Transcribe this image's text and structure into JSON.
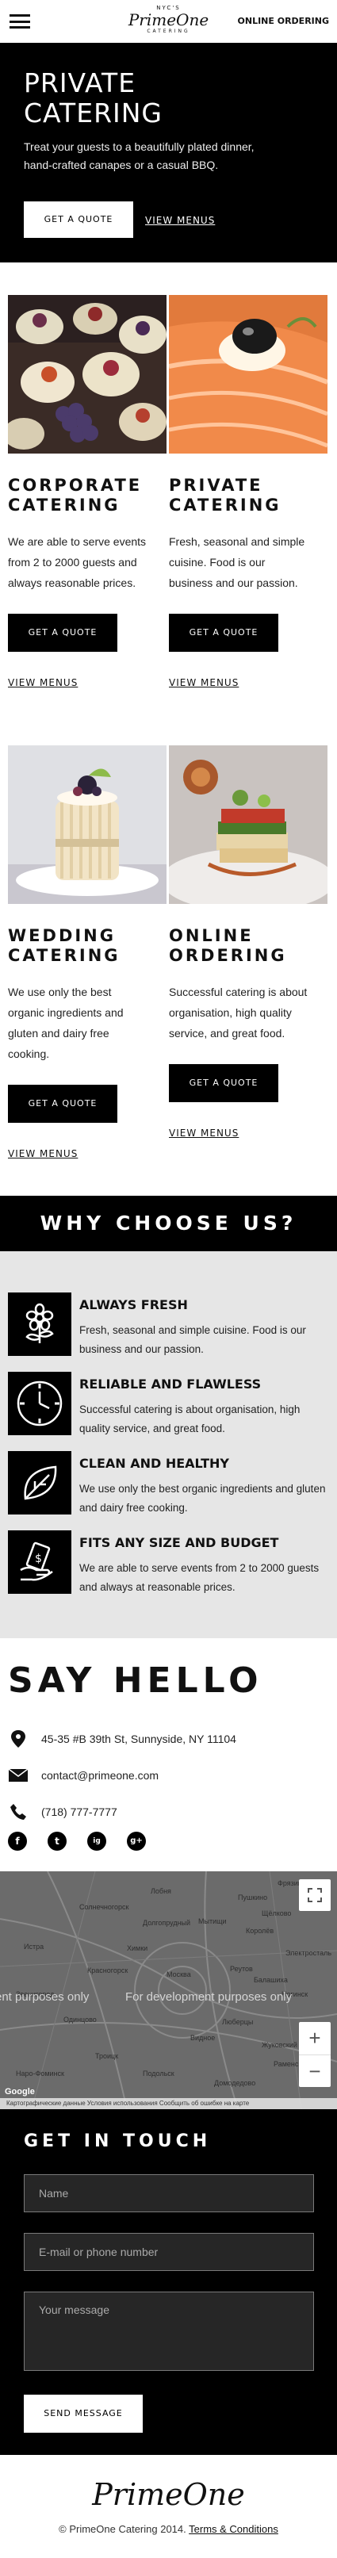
{
  "header": {
    "logo_top": "NYC'S",
    "logo_main": "PrimeOne",
    "logo_sub": "CATERING",
    "online_ordering": "ONLINE ORDERING"
  },
  "hero": {
    "title_line1": "PRIVATE",
    "title_line2": "CATERING",
    "text": "Treat your guests to a beautifully plated dinner, hand-crafted canapes or a casual BBQ.",
    "quote_button": "GET A QUOTE",
    "menus_link": "VIEW MENUS"
  },
  "services": [
    {
      "title1": "CORPORATE",
      "title2": "CATERING",
      "text": "We are able to serve events from 2 to 2000 guests and always reasonable prices.",
      "button": "GET A QUOTE",
      "link": "VIEW MENUS"
    },
    {
      "title1": "PRIVATE",
      "title2": "CATERING",
      "text": "Fresh, seasonal and simple cuisine. Food is our business and our passion.",
      "button": "GET A QUOTE",
      "link": "VIEW MENUS"
    },
    {
      "title1": "WEDDING",
      "title2": "CATERING",
      "text": "We use only the best organic ingredients and gluten and dairy free cooking.",
      "button": "GET A QUOTE",
      "link": "VIEW MENUS"
    },
    {
      "title1": "ONLINE",
      "title2": "ORDERING",
      "text": "Successful catering is about organisation, high quality service, and great food.",
      "button": "GET A QUOTE",
      "link": "VIEW MENUS"
    }
  ],
  "why": {
    "title": "WHY CHOOSE US?",
    "items": [
      {
        "title": "ALWAYS FRESH",
        "text": "Fresh, seasonal and simple cuisine. Food is our business and our passion.",
        "icon": "flower-icon"
      },
      {
        "title": "RELIABLE AND FLAWLESS",
        "text": "Successful catering is about organisation, high quality service, and great food.",
        "icon": "clock-icon"
      },
      {
        "title": "CLEAN AND HEALTHY",
        "text": "We use only the best organic ingredients and gluten and dairy free cooking.",
        "icon": "leaf-icon"
      },
      {
        "title": "FITS ANY SIZE AND BUDGET",
        "text": "We are able to serve events from 2 to 2000 guests and always at reasonable prices.",
        "icon": "money-hand-icon"
      }
    ]
  },
  "hello": {
    "title": "SAY HELLO",
    "address": "45-35 #B 39th St, Sunnyside, NY 11104",
    "email": "contact@primeone.com",
    "phone": "(718) 777-7777",
    "socials": [
      "f",
      "t",
      "ig",
      "g+"
    ]
  },
  "map": {
    "dev_text": "For development purposes only",
    "dev_text_left": "ent purposes only",
    "labels": [
      "Лобня",
      "Пушкино",
      "Королёв",
      "Мытищи",
      "Балашиха",
      "Химки",
      "Москва",
      "Реутов",
      "Красногорск",
      "Одинцово",
      "Подольск",
      "Домодедово",
      "Жуковский",
      "Люберцы",
      "Раменское",
      "Электросталь",
      "Ногинск",
      "Звенигород",
      "Истра",
      "Солнечногорск",
      "Щёлково",
      "Фрязино",
      "Видное",
      "Троицк",
      "Наро-Фоминск",
      "Долгопрудный"
    ],
    "attribution": "Картографические данные   Условия использования   Сообщить об ошибке на карте",
    "google": "Google",
    "zoom_in": "+",
    "zoom_out": "−"
  },
  "contact_form": {
    "title": "GET IN TOUCH",
    "name_placeholder": "Name",
    "email_placeholder": "E-mail or phone number",
    "message_placeholder": "Your message",
    "send_button": "SEND MESSAGE"
  },
  "footer": {
    "logo": "PrimeOne",
    "copyright": "© PrimeOne Catering 2014.",
    "terms": "Terms & Conditions"
  },
  "colors": {
    "black": "#000000",
    "grey_band": "#e6e6e6",
    "field_bg": "#262626"
  }
}
